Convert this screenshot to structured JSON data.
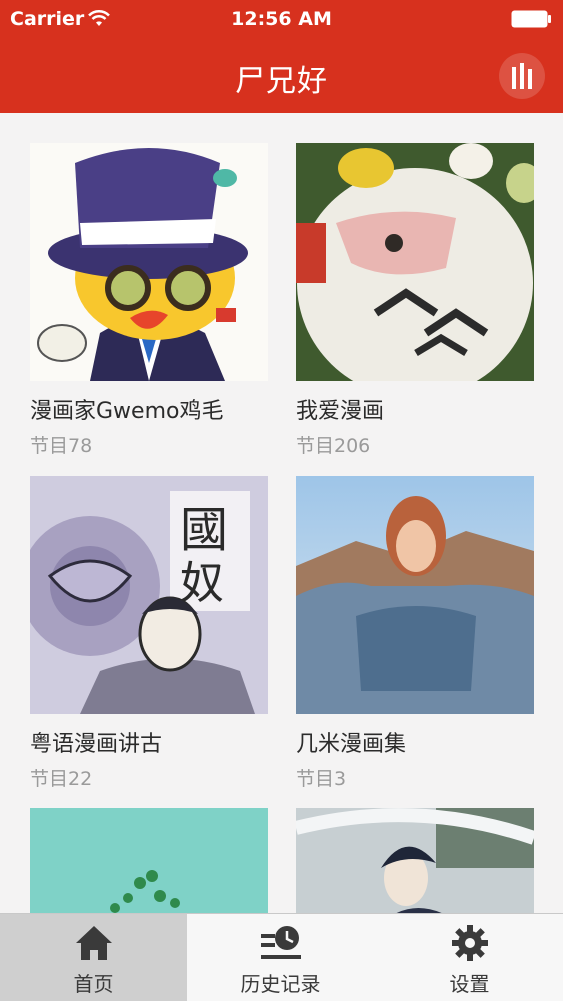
{
  "status": {
    "carrier": "Carrier",
    "time": "12:56 AM"
  },
  "nav": {
    "title": "尸兄好"
  },
  "cards": [
    {
      "title": "漫画家Gwemo鸡毛",
      "subtitle": "节目78"
    },
    {
      "title": "我爱漫画",
      "subtitle": "节目206"
    },
    {
      "title": "粤语漫画讲古",
      "subtitle": "节目22"
    },
    {
      "title": "几米漫画集",
      "subtitle": "节目3"
    }
  ],
  "tabs": [
    {
      "label": "首页",
      "icon": "home-icon"
    },
    {
      "label": "历史记录",
      "icon": "history-icon"
    },
    {
      "label": "设置",
      "icon": "gear-icon"
    }
  ],
  "colors": {
    "primary": "#d7311e",
    "tab_active_bg": "#cfcfcf"
  }
}
